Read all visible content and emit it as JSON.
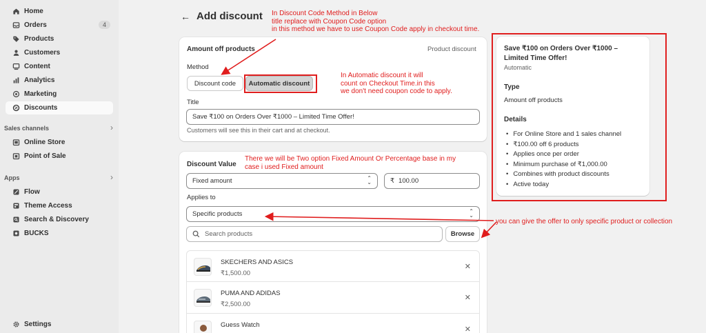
{
  "sidebar": {
    "items": [
      {
        "label": "Home",
        "icon": "home-icon"
      },
      {
        "label": "Orders",
        "icon": "orders-icon",
        "count": "4"
      },
      {
        "label": "Products",
        "icon": "tag-icon"
      },
      {
        "label": "Customers",
        "icon": "person-icon"
      },
      {
        "label": "Content",
        "icon": "content-icon"
      },
      {
        "label": "Analytics",
        "icon": "analytics-icon"
      },
      {
        "label": "Marketing",
        "icon": "target-icon"
      },
      {
        "label": "Discounts",
        "icon": "discount-icon",
        "active": true
      }
    ],
    "sales_channels_label": "Sales channels",
    "sales_channels": [
      {
        "label": "Online Store",
        "icon": "store-icon"
      },
      {
        "label": "Point of Sale",
        "icon": "pos-icon"
      }
    ],
    "apps_label": "Apps",
    "apps": [
      {
        "label": "Flow",
        "icon": "flow-icon"
      },
      {
        "label": "Theme Access",
        "icon": "theme-access-icon"
      },
      {
        "label": "Search & Discovery",
        "icon": "search-discovery-icon"
      },
      {
        "label": "BUCKS",
        "icon": "bucks-icon"
      }
    ],
    "settings": {
      "label": "Settings",
      "icon": "gear-icon"
    }
  },
  "page": {
    "title": "Add discount"
  },
  "method_card": {
    "title": "Amount off products",
    "type_label": "Product discount",
    "method_label": "Method",
    "method_options": [
      "Discount code",
      "Automatic discount"
    ],
    "selected_method": "Automatic discount",
    "title_label": "Title",
    "title_value": "Save ₹100 on Orders Over ₹1000 – Limited Time Offer!",
    "title_help": "Customers will see this in their cart and at checkout."
  },
  "value_card": {
    "discount_value_label": "Discount Value",
    "value_type": "Fixed amount",
    "amount_prefix": "₹",
    "amount": "100.00",
    "applies_to_label": "Applies to",
    "applies_to_value": "Specific products",
    "search_placeholder": "Search products",
    "browse_label": "Browse",
    "products": [
      {
        "name": "SKECHERS AND ASICS",
        "price": "₹1,500.00"
      },
      {
        "name": "PUMA AND ADIDAS",
        "price": "₹2,500.00"
      },
      {
        "name": "Guess Watch",
        "price": ""
      }
    ]
  },
  "summary": {
    "title": "Save ₹100 on Orders Over ₹1000 – Limited Time Offer!",
    "method": "Automatic",
    "type_heading": "Type",
    "type_value": "Amount off products",
    "details_heading": "Details",
    "details": [
      "For Online Store and 1 sales channel",
      "₹100.00 off 6 products",
      "Applies once per order",
      "Minimum purchase of ₹1,000.00",
      "Combines with product discounts",
      "Active today"
    ]
  },
  "annotations": {
    "discount_code_note": [
      "In Discount Code Method in Below",
      "title replace with Coupon Code option",
      "in this method we have to use Coupon Code apply in checkout time."
    ],
    "automatic_note": [
      "In Automatic discount it will",
      "count on Checkout Time.in this",
      "we don't need coupon code to apply."
    ],
    "value_note": [
      "There we will be Two option Fixed Amount Or Percentage base in my",
      "case i used Fixed amount"
    ],
    "applies_note": "you can give the offer to only specific product or collection"
  },
  "colors": {
    "annotation": "#e01d1d",
    "sidebar_bg": "#ebebeb",
    "page_bg": "#f1f1f1",
    "card_bg": "#ffffff"
  }
}
